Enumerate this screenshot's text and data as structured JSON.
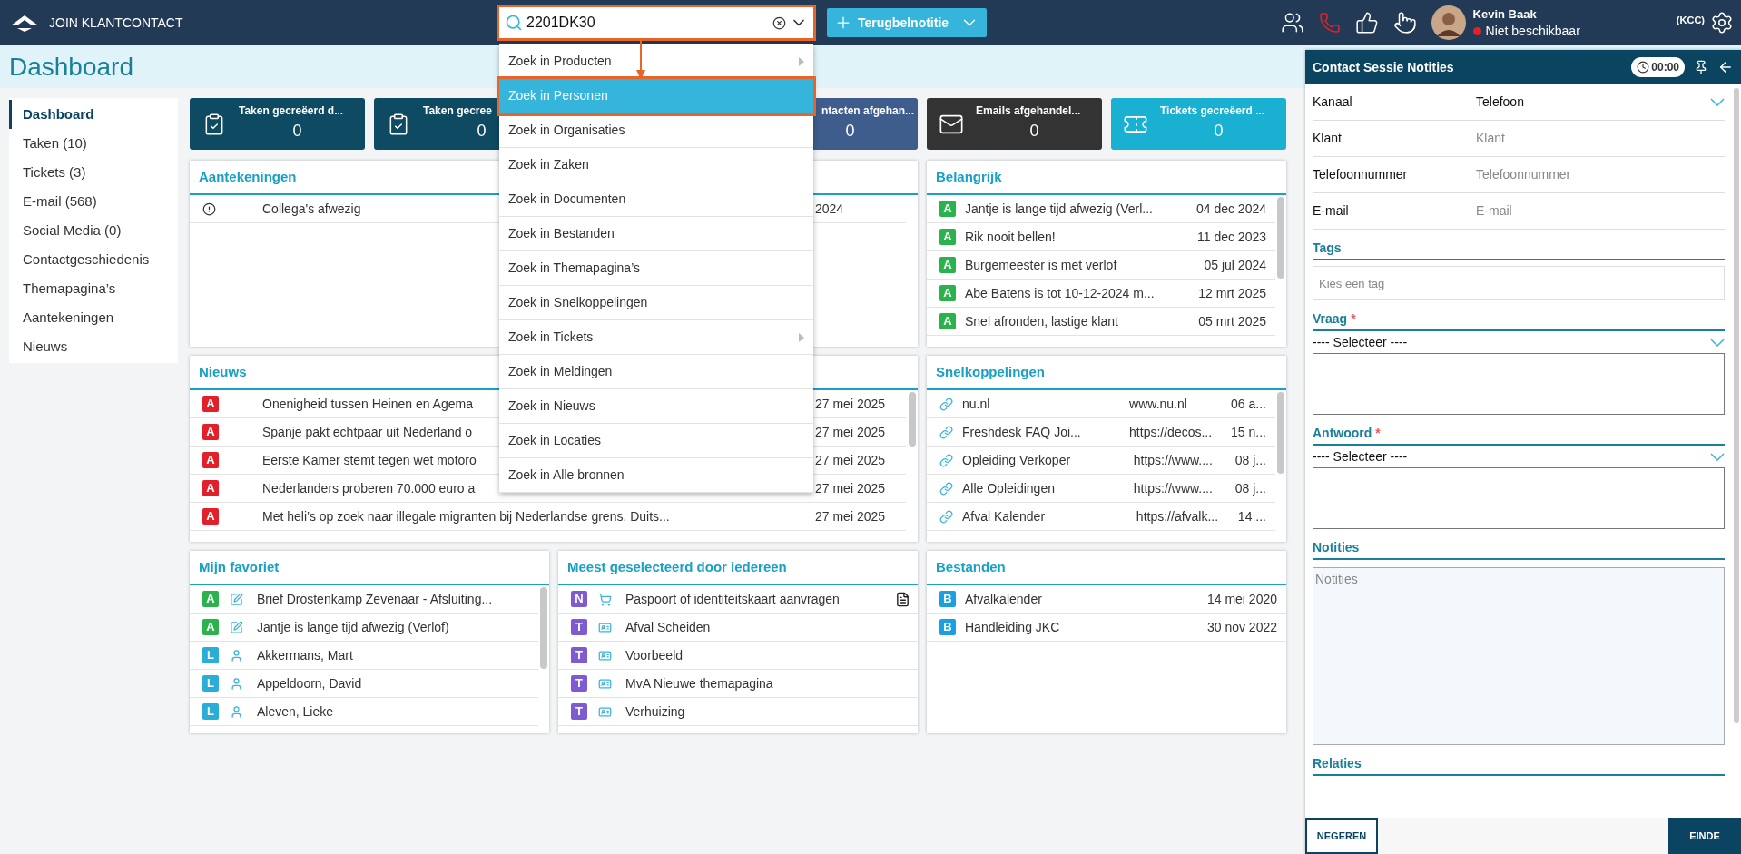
{
  "topbar": {
    "brand": "JOIN KLANTCONTACT",
    "search": {
      "value": "2201DK30"
    },
    "callback_button": "Terugbelnotitie",
    "user": {
      "name": "Kevin Baak",
      "status": {
        "text": "Niet beschikbaar",
        "color": "#e3202a"
      },
      "role": "(KCC)"
    }
  },
  "search_menu": [
    {
      "label": "Zoek in Producten",
      "submenu": true,
      "selected": false
    },
    {
      "label": "Zoek in Personen",
      "submenu": false,
      "selected": true
    },
    {
      "label": "Zoek in Organisaties",
      "submenu": false,
      "selected": false
    },
    {
      "label": "Zoek in Zaken",
      "submenu": false,
      "selected": false
    },
    {
      "label": "Zoek in Documenten",
      "submenu": false,
      "selected": false
    },
    {
      "label": "Zoek in Bestanden",
      "submenu": false,
      "selected": false
    },
    {
      "label": "Zoek in Themapagina’s",
      "submenu": false,
      "selected": false
    },
    {
      "label": "Zoek in Snelkoppelingen",
      "submenu": false,
      "selected": false
    },
    {
      "label": "Zoek in Tickets",
      "submenu": true,
      "selected": false
    },
    {
      "label": "Zoek in Meldingen",
      "submenu": false,
      "selected": false
    },
    {
      "label": "Zoek in Nieuws",
      "submenu": false,
      "selected": false
    },
    {
      "label": "Zoek in Locaties",
      "submenu": false,
      "selected": false
    },
    {
      "label": "Zoek in Alle bronnen",
      "submenu": false,
      "selected": false
    }
  ],
  "page_title": "Dashboard",
  "sidebar": [
    {
      "label": "Dashboard",
      "selected": true
    },
    {
      "label": "Taken (10)",
      "selected": false
    },
    {
      "label": "Tickets (3)",
      "selected": false
    },
    {
      "label": "E-mail (568)",
      "selected": false
    },
    {
      "label": "Social Media (0)",
      "selected": false
    },
    {
      "label": "Contactgeschiedenis",
      "selected": false
    },
    {
      "label": "Themapagina’s",
      "selected": false
    },
    {
      "label": "Aantekeningen",
      "selected": false
    },
    {
      "label": "Nieuws",
      "selected": false
    }
  ],
  "stat_cards": [
    {
      "kind": "tasks",
      "label": "Taken gecreëerd d...",
      "value": "0",
      "color": "#0f4a63"
    },
    {
      "kind": "tasks",
      "label": "Taken gecree",
      "value": "0",
      "color": "#0f4a63"
    },
    {
      "label": "ntacten afgehan...",
      "value": "0",
      "color": "#3e5d8c"
    },
    {
      "kind": "mail",
      "label": "Emails afgehandel...",
      "value": "0",
      "color": "#333333"
    },
    {
      "kind": "ticket",
      "label": "Tickets gecreëerd ...",
      "value": "0",
      "color": "#19b0d2"
    }
  ],
  "panels": [
    {
      "title": "Aantekeningen",
      "wide": true,
      "scrollable": false,
      "rows": [
        {
          "kind": "info",
          "title": "Collega's afwezig",
          "date": "2024"
        }
      ]
    },
    {
      "title": "Belangrijk",
      "wide": false,
      "scrollable": true,
      "rows": [
        {
          "badge": "A",
          "color": "#2bb24c",
          "title": "Jantje is lange tijd afwezig (Verl...",
          "date": "04 dec 2024"
        },
        {
          "badge": "A",
          "color": "#2bb24c",
          "title": "Rik nooit bellen!",
          "date": "11 dec 2023"
        },
        {
          "badge": "A",
          "color": "#2bb24c",
          "title": "Burgemeester is met verlof",
          "date": "05 jul 2024"
        },
        {
          "badge": "A",
          "color": "#2bb24c",
          "title": "Abe Batens is tot 10-12-2024 m...",
          "date": "12 mrt 2025"
        },
        {
          "badge": "A",
          "color": "#2bb24c",
          "title": "Snel afronden, lastige klant",
          "date": "05 mrt 2025"
        }
      ]
    },
    {
      "title": "Nieuws",
      "wide": true,
      "scrollable": true,
      "rows": [
        {
          "badge": "A",
          "color": "#e3202a",
          "title": "Onenigheid tussen Heinen en Agema",
          "date": "27 mei 2025"
        },
        {
          "badge": "A",
          "color": "#e3202a",
          "title": "Spanje pakt echtpaar uit Nederland o",
          "date": "27 mei 2025"
        },
        {
          "badge": "A",
          "color": "#e3202a",
          "title": "Eerste Kamer stemt tegen wet motoro",
          "date": "27 mei 2025"
        },
        {
          "badge": "A",
          "color": "#e3202a",
          "title": "Nederlanders proberen 70.000 euro a",
          "date": "27 mei 2025"
        },
        {
          "badge": "A",
          "color": "#e3202a",
          "title": "Met heli’s op zoek naar illegale migranten bij Nederlandse grens. Duits...",
          "date": "27 mei 2025"
        }
      ]
    },
    {
      "title": "Snelkoppelingen",
      "wide": false,
      "scrollable": true,
      "rows": [
        {
          "kind": "link",
          "title": "nu.nl",
          "url": "www.nu.nl",
          "date": "06 a..."
        },
        {
          "kind": "link",
          "title": "Freshdesk FAQ Joi...",
          "url": "https://decos...",
          "date": "15 n..."
        },
        {
          "kind": "link",
          "title": "Opleiding Verkoper",
          "url": "https://www....",
          "date": "08 j..."
        },
        {
          "kind": "link",
          "title": "Alle Opleidingen",
          "url": "https://www....",
          "date": "08 j..."
        },
        {
          "kind": "link",
          "title": "Afval Kalender",
          "url": "https://afvalk...",
          "date": "14 ..."
        }
      ]
    },
    {
      "title": "Mijn favoriet",
      "wide": false,
      "scrollable": true,
      "rows": [
        {
          "badge": "A",
          "color": "#2bb24c",
          "kind": "edit",
          "title": "Brief Drostenkamp Zevenaar - Afsluiting..."
        },
        {
          "badge": "A",
          "color": "#2bb24c",
          "kind": "edit",
          "title": "Jantje is lange tijd afwezig (Verlof)"
        },
        {
          "badge": "L",
          "color": "#2aaed8",
          "kind": "person",
          "title": "Akkermans, Mart"
        },
        {
          "badge": "L",
          "color": "#2aaed8",
          "kind": "person",
          "title": "Appeldoorn, David"
        },
        {
          "badge": "L",
          "color": "#2aaed8",
          "kind": "person",
          "title": "Aleven, Lieke"
        }
      ]
    },
    {
      "title": "Meest geselecteerd door iedereen",
      "wide": false,
      "scrollable": false,
      "rows": [
        {
          "badge": "N",
          "color": "#7e5bd1",
          "kind": "cart",
          "title": "Paspoort of identiteitskaart aanvragen",
          "doc": true
        },
        {
          "badge": "T",
          "color": "#7e5bd1",
          "kind": "card",
          "title": "Afval Scheiden",
          "doc": false
        },
        {
          "badge": "T",
          "color": "#7e5bd1",
          "kind": "card",
          "title": "Voorbeeld",
          "doc": false
        },
        {
          "badge": "T",
          "color": "#7e5bd1",
          "kind": "card",
          "title": "MvA Nieuwe themapagina",
          "doc": false
        },
        {
          "badge": "T",
          "color": "#7e5bd1",
          "kind": "card",
          "title": "Verhuizing",
          "doc": false
        }
      ]
    },
    {
      "title": "Bestanden",
      "wide": false,
      "scrollable": false,
      "rows": [
        {
          "badge": "B",
          "color": "#1a9fe0",
          "title": "Afvalkalender",
          "date": "14 mei 2020"
        },
        {
          "badge": "B",
          "color": "#1a9fe0",
          "title": "Handleiding JKC",
          "date": "30 nov 2022"
        }
      ]
    }
  ],
  "session": {
    "title": "Contact Sessie Notities",
    "timer": "00:00",
    "fields": [
      {
        "label": "Kanaal",
        "kind": "select",
        "value": "Telefoon"
      },
      {
        "label": "Klant",
        "kind": "text",
        "placeholder": "Klant"
      },
      {
        "label": "Telefoonnummer",
        "kind": "text",
        "placeholder": "Telefoonnummer"
      },
      {
        "label": "E-mail",
        "kind": "text",
        "placeholder": "E-mail"
      }
    ],
    "tags": {
      "title": "Tags",
      "placeholder": "Kies een tag"
    },
    "vraag": {
      "title": "Vraag",
      "required_mark": "*",
      "select": "---- Selecteer ----"
    },
    "antwoord": {
      "title": "Antwoord",
      "required_mark": "*",
      "select": "---- Selecteer ----"
    },
    "notities": {
      "title": "Notities",
      "placeholder": "Notities"
    },
    "relaties": {
      "title": "Relaties"
    },
    "buttons": {
      "ignore": "NEGEREN",
      "end": "EINDE"
    }
  }
}
